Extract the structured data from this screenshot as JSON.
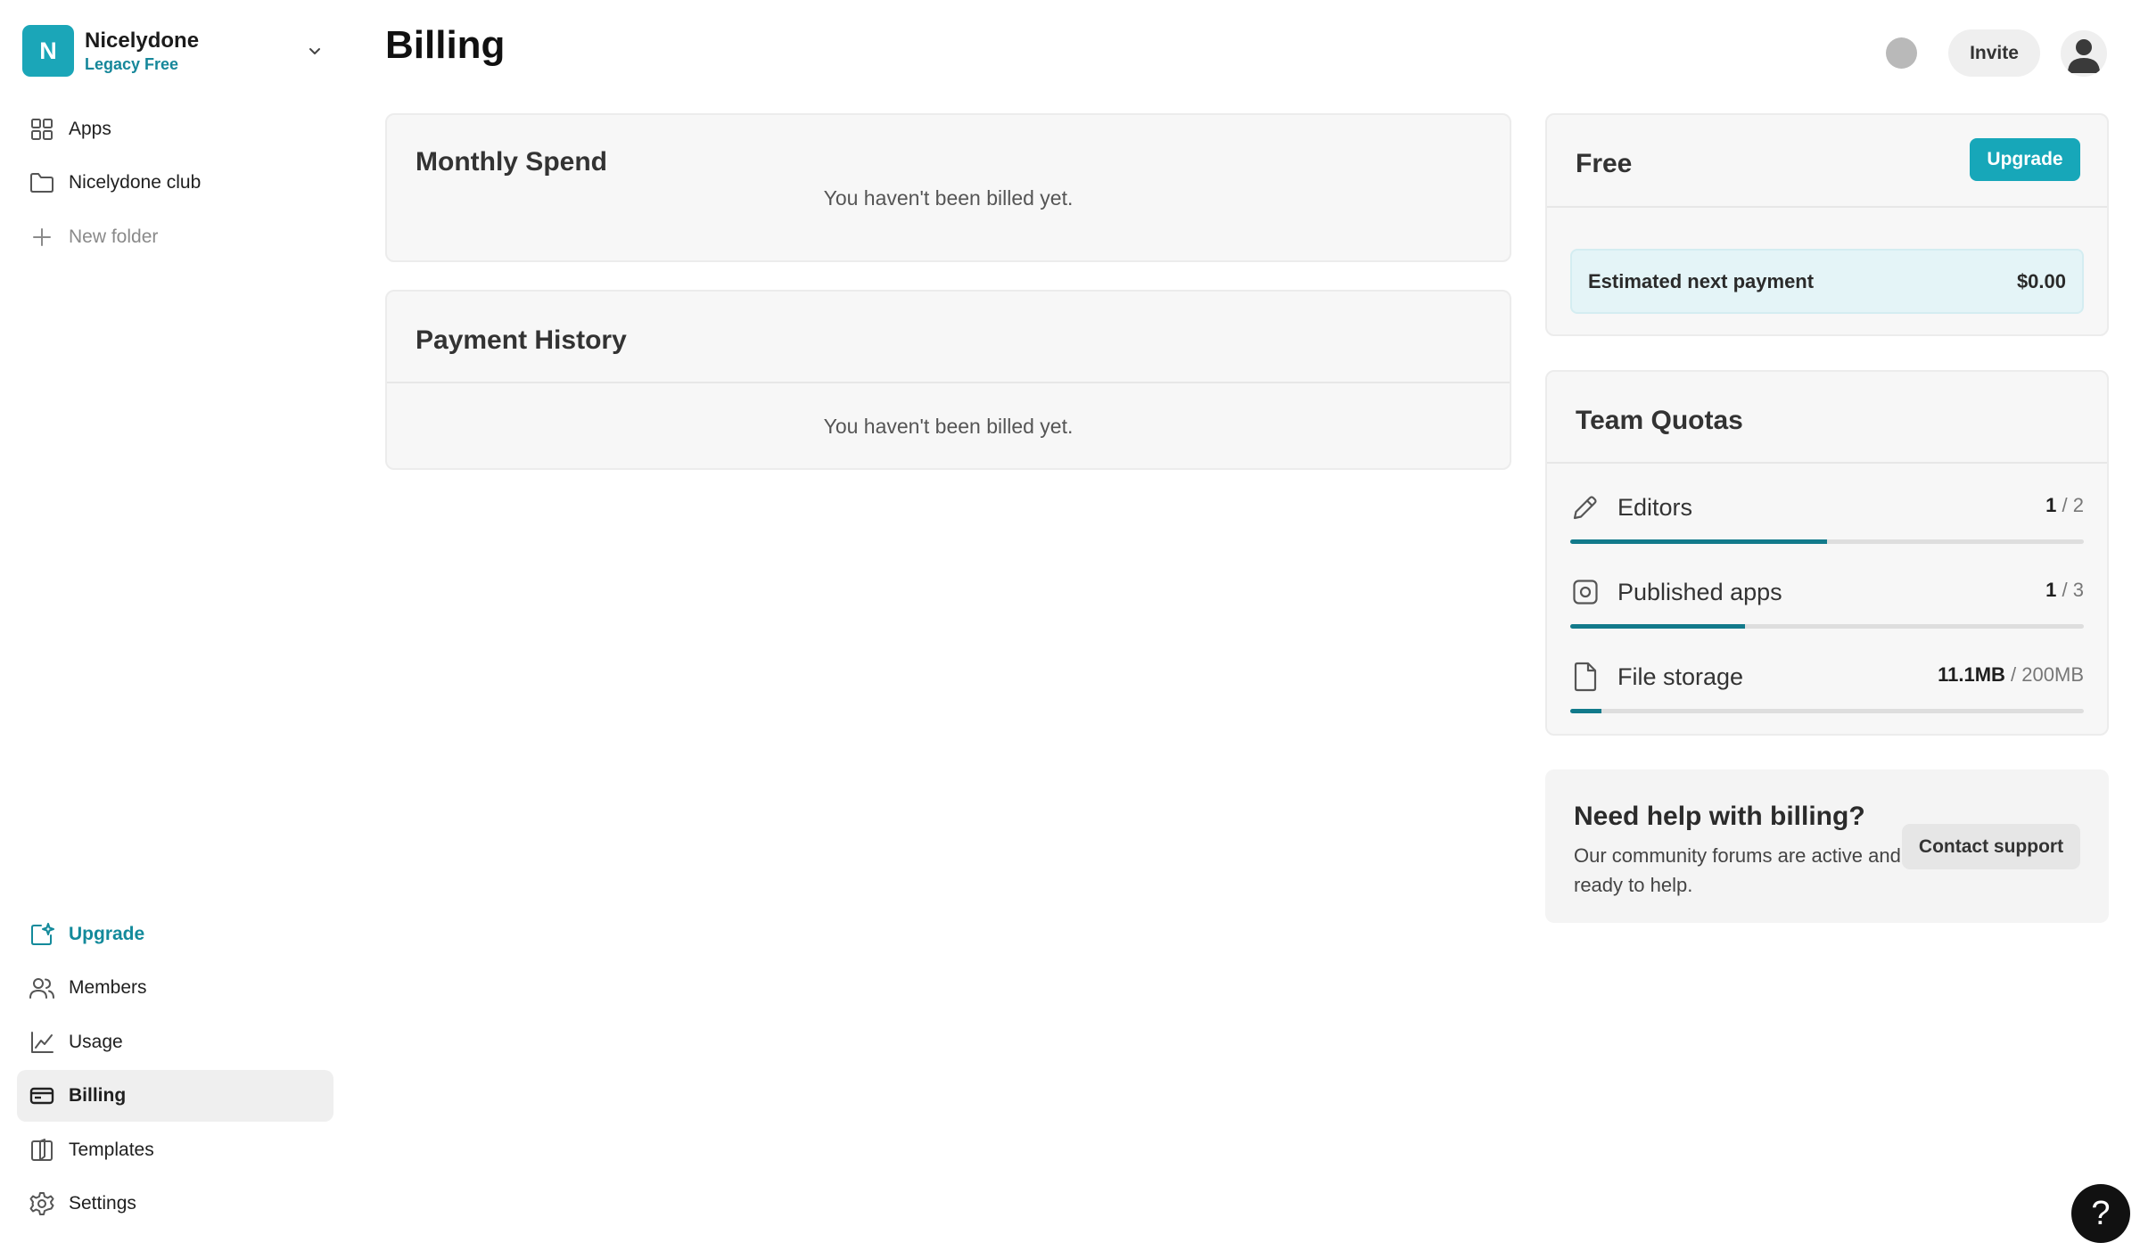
{
  "team": {
    "initial": "N",
    "name": "Nicelydone",
    "plan": "Legacy Free"
  },
  "sidebar": {
    "top_items": [
      {
        "label": "Apps",
        "icon": "grid-icon"
      },
      {
        "label": "Nicelydone club",
        "icon": "folder-icon"
      },
      {
        "label": "New folder",
        "icon": "plus-icon"
      }
    ],
    "bottom_items": [
      {
        "label": "Upgrade",
        "icon": "upgrade-icon"
      },
      {
        "label": "Members",
        "icon": "users-icon"
      },
      {
        "label": "Usage",
        "icon": "chart-line-icon"
      },
      {
        "label": "Billing",
        "icon": "credit-card-icon",
        "active": true
      },
      {
        "label": "Templates",
        "icon": "book-icon"
      },
      {
        "label": "Settings",
        "icon": "gear-icon"
      }
    ]
  },
  "header": {
    "title": "Billing",
    "invite_label": "Invite"
  },
  "monthly_spend": {
    "title": "Monthly Spend",
    "empty_text": "You haven't been billed yet."
  },
  "payment_history": {
    "title": "Payment History",
    "empty_text": "You haven't been billed yet."
  },
  "plan": {
    "name": "Free",
    "upgrade_label": "Upgrade",
    "estimate_label": "Estimated next payment",
    "estimate_value": "$0.00"
  },
  "quotas": {
    "title": "Team Quotas",
    "items": [
      {
        "label": "Editors",
        "used": "1",
        "sep": " / ",
        "max": "2",
        "fraction": 0.5,
        "icon": "pencil-icon"
      },
      {
        "label": "Published apps",
        "used": "1",
        "sep": " / ",
        "max": "3",
        "fraction": 0.34,
        "icon": "published-app-icon"
      },
      {
        "label": "File storage",
        "used": "11.1MB",
        "sep": " / ",
        "max": "200MB",
        "fraction": 0.06,
        "icon": "file-icon"
      }
    ]
  },
  "help": {
    "title": "Need help with billing?",
    "description": "Our community forums are active and ready to help.",
    "contact_label": "Contact support",
    "fab_label": "?"
  },
  "colors": {
    "accent": "#17a7b9",
    "accent_dark": "#127a8b",
    "accent_text": "#138a9b"
  }
}
